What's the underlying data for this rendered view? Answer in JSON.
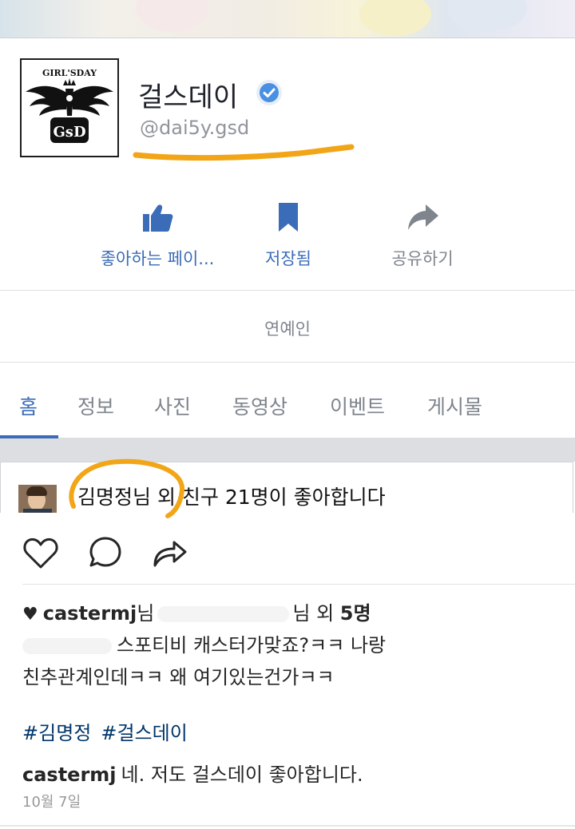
{
  "profile": {
    "logo_text_top": "GIRL'SDAY",
    "logo_text_bottom": "GsD",
    "name": "걸스데이",
    "handle": "@dai5y.gsd"
  },
  "actions": {
    "like_label": "좋아하는 페이...",
    "save_label": "저장됨",
    "share_label": "공유하기"
  },
  "category": "연예인",
  "tabs": [
    {
      "label": "홈"
    },
    {
      "label": "정보"
    },
    {
      "label": "사진"
    },
    {
      "label": "동영상"
    },
    {
      "label": "이벤트"
    },
    {
      "label": "게시물"
    }
  ],
  "friends_like_text": "김명정님 외 친구 21명이 좋아합니다",
  "post": {
    "likes_user": "castermj",
    "likes_suffix_1": "님",
    "likes_suffix_2": "님 외",
    "likes_count": "5명",
    "caption_line1": "스포티비 캐스터가맞죠?ㅋㅋ 나랑",
    "caption_line2": "친추관계인데ㅋㅋ 왜 여기있는건가ㅋㅋ",
    "hashtags": [
      "#김명정",
      "#걸스데이"
    ],
    "comment_user": "castermj",
    "comment_text": "네. 저도 걸스데이 좋아합니다.",
    "date": "10월 7일"
  },
  "colors": {
    "facebook_blue": "#3b6cb7",
    "verified_blue": "#4a90e2",
    "marker_orange": "#f2a516",
    "muted_gray": "#7f858d",
    "instagram_link": "#003569"
  },
  "icons": [
    "thumbs-up-icon",
    "bookmark-icon",
    "share-arrow-icon",
    "verified-badge-icon",
    "heart-outline-icon",
    "comment-bubble-icon",
    "share-icon"
  ]
}
